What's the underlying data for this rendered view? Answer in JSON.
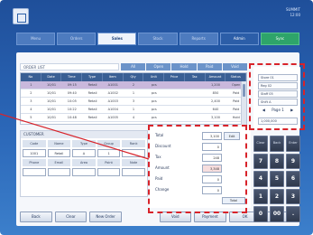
{
  "device": {
    "status_lines": [
      "SUMMIT",
      "12:00"
    ]
  },
  "tabs": [
    {
      "label": "Menu"
    },
    {
      "label": "Orders"
    },
    {
      "label": "Sales"
    },
    {
      "label": "Stock"
    },
    {
      "label": "Reports"
    },
    {
      "label": "Admin"
    },
    {
      "label": "Sync"
    }
  ],
  "list": {
    "title": "ORDER LIST",
    "sub_tabs": [
      "All",
      "Open",
      "Hold",
      "Paid",
      "Void"
    ],
    "columns": [
      "No",
      "Date",
      "Time",
      "Type",
      "Item",
      "Qty",
      "Unit",
      "Price",
      "Tax",
      "Amount",
      "Status"
    ],
    "rows": [
      [
        "1",
        "10/01",
        "09:15",
        "Retail",
        "A1001",
        "2",
        "pcs",
        "",
        "",
        "1,200",
        "Open"
      ],
      [
        "2",
        "10/01",
        "09:40",
        "Retail",
        "A1002",
        "1",
        "pcs",
        "",
        "",
        "850",
        "Paid"
      ],
      [
        "3",
        "10/01",
        "10:05",
        "Retail",
        "A1003",
        "3",
        "pcs",
        "",
        "",
        "2,400",
        "Paid"
      ],
      [
        "4",
        "10/01",
        "10:22",
        "Retail",
        "A1004",
        "1",
        "pcs",
        "",
        "",
        "640",
        "Paid"
      ],
      [
        "5",
        "10/01",
        "10:48",
        "Retail",
        "A1005",
        "4",
        "pcs",
        "",
        "",
        "3,100",
        "Hold"
      ]
    ]
  },
  "form": {
    "title": "CUSTOMER",
    "labels_1": [
      "Code",
      "Name",
      "Type",
      "Group",
      "Rank"
    ],
    "values_1": [
      "1001",
      "Retail",
      "A",
      "1",
      ""
    ],
    "labels_2": [
      "Phone",
      "Email",
      "Area",
      "Point",
      "Note"
    ],
    "values_2": [
      "",
      "",
      "",
      "",
      ""
    ]
  },
  "detail": {
    "rows": [
      {
        "label": "Total",
        "value": "3,100",
        "value2": "Edit"
      },
      {
        "label": "Discount",
        "value": "0"
      },
      {
        "label": "Tax",
        "value": "248"
      },
      {
        "label": "Amount",
        "value": "3,348"
      },
      {
        "label": "Paid",
        "value": "0"
      },
      {
        "label": "Change",
        "value": "0"
      }
    ],
    "total_label": "Total"
  },
  "actions": [
    "Back",
    "Clear",
    "New Order",
    "",
    "Void",
    "Payment",
    "OK",
    "Next"
  ],
  "side_panel": {
    "fields": [
      "Store 01",
      "Reg 02",
      "Staff 05",
      "Shift A"
    ],
    "controls": [
      "◀",
      "Page 1",
      "▶"
    ],
    "footer": "1,000,000"
  },
  "keypad": [
    "Clear",
    "Back",
    "Enter",
    "7",
    "8",
    "9",
    "4",
    "5",
    "6",
    "1",
    "2",
    "3",
    "0",
    "00",
    "."
  ]
}
